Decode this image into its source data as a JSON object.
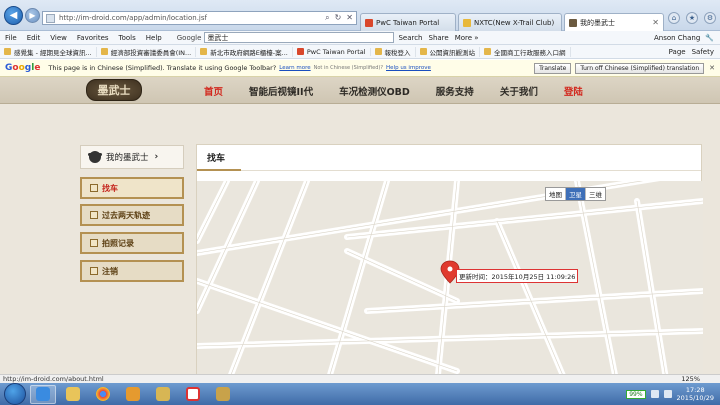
{
  "browser": {
    "address": "http://im-droid.com/app/admin/location.jsf",
    "tabs": [
      {
        "label": "PwC Taiwan Portal",
        "active": false,
        "color": "#d9472b"
      },
      {
        "label": "NXTC(New X-Trail Club)",
        "active": false,
        "color": "#e8b83a"
      },
      {
        "label": "我的墨武士",
        "active": true,
        "color": "#6b5a40"
      }
    ],
    "menu": [
      "File",
      "Edit",
      "View",
      "Favorites",
      "Tools",
      "Help"
    ],
    "google_label": "Google",
    "search_value": "墨武士",
    "toolbar_items": [
      "Search",
      "Share",
      "More »"
    ],
    "user": "Anson Chang",
    "favorites": [
      "感覺集 - 經期見全球資訊...",
      "經濟部投資審議委員會(IN...",
      "新北市政府網路E櫃檯-案...",
      "PwC Taiwan Portal",
      "報稅登入",
      "公開資訊觀測站",
      "全國商工行政服務入口網"
    ],
    "fav_tools": [
      "Page",
      "Safety"
    ],
    "translate": {
      "message": "This page is in Chinese (Simplified).  Translate it using Google Toolbar?",
      "learn_more": "Learn more",
      "note": "Not in Chinese (Simplified)?",
      "help": "Help us improve",
      "translate_btn": "Translate",
      "off_btn": "Turn off Chinese (Simplified) translation"
    },
    "status_url": "http://im-droid.com/about.html",
    "zoom": "125%"
  },
  "site": {
    "logo": "墨武士",
    "nav": [
      {
        "label": "首页",
        "active": true
      },
      {
        "label": "智能后视镜II代",
        "active": false
      },
      {
        "label": "车况检测仪OBD",
        "active": false
      },
      {
        "label": "服务支持",
        "active": false
      },
      {
        "label": "关于我们",
        "active": false
      },
      {
        "label": "登陆",
        "active": false
      }
    ],
    "sidebar": {
      "header": "我的墨武士",
      "items": [
        {
          "label": "找车",
          "active": true
        },
        {
          "label": "过去两天轨迹",
          "active": false
        },
        {
          "label": "拍照记录",
          "active": false
        },
        {
          "label": "注销",
          "active": false
        }
      ]
    },
    "content_title": "找车",
    "map": {
      "types": [
        "地图",
        "卫星",
        "三维"
      ],
      "selected_type": "卫星",
      "tooltip": "更新时间：2015年10月25日 11:09:26",
      "marker_color": "#e03a2e"
    }
  },
  "taskbar": {
    "apps": [
      "ie",
      "explorer",
      "chrome",
      "outlook",
      "windows-explorer",
      "gmail",
      "mail"
    ],
    "battery": "99%",
    "time": "17:28",
    "date": "2015/10/29"
  }
}
